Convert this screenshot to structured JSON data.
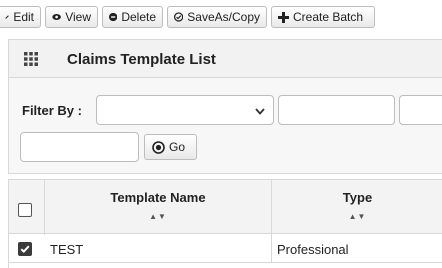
{
  "toolbar": {
    "edit_label": "Edit",
    "view_label": "View",
    "delete_label": "Delete",
    "saveas_label": "SaveAs/Copy",
    "create_batch_label": "Create Batch"
  },
  "panel": {
    "title": "Claims Template List"
  },
  "filter": {
    "label": "Filter By :",
    "select_value": "",
    "text_value_1": "",
    "text_value_2": "",
    "text_value_3": "",
    "go_label": "Go"
  },
  "table": {
    "columns": [
      "Template Name",
      "Type"
    ],
    "sort_indicator": "▲▼",
    "rows": [
      {
        "checked": true,
        "template_name": "TEST",
        "type": "Professional"
      }
    ]
  },
  "icons": [
    "pencil-icon",
    "eye-icon",
    "minus-circle-icon",
    "check-circle-icon",
    "plus-icon",
    "grid-icon",
    "chevron-down-icon",
    "go-circle-icon",
    "checkbox-icon"
  ]
}
